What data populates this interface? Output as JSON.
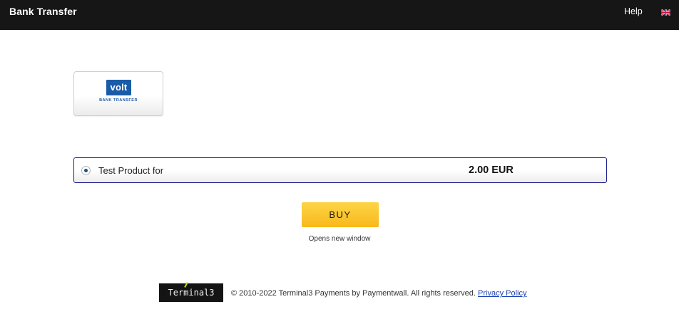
{
  "header": {
    "title": "Bank Transfer",
    "help_label": "Help",
    "language_flag_icon": "uk-flag-icon"
  },
  "payment_method": {
    "logo_text": "volt",
    "sub_text": "BANK TRANSFER",
    "brand_color": "#1a5ba8"
  },
  "product": {
    "name": "Test Product for",
    "price": "2.00 EUR",
    "selected": true
  },
  "buy": {
    "label": "BUY",
    "note": "Opens new window",
    "color": "#f8b81b"
  },
  "footer": {
    "logo_text": "Terminal3",
    "copyright": "© 2010-2022 Terminal3 Payments by Paymentwall. All rights reserved.",
    "privacy_label": "Privacy Policy"
  }
}
